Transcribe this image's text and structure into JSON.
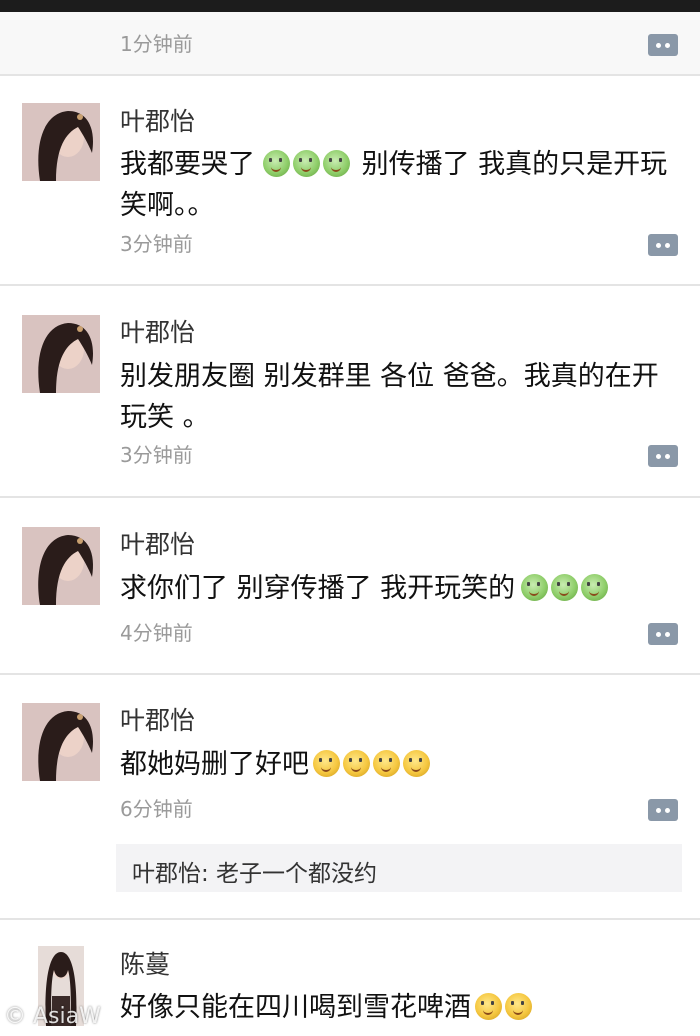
{
  "first_time": "1分钟前",
  "comments": [
    {
      "name": "叶郡怡",
      "text_a": "我都要哭了",
      "text_b": " 别传播了 我真的只是开玩笑啊。。",
      "emojis_a": [
        "green-face",
        "green-face",
        "green-face"
      ],
      "time": "3分钟前"
    },
    {
      "name": "叶郡怡",
      "text": "别发朋友圈 别发群里 各位 爸爸。我真的在开玩笑 。",
      "time": "3分钟前"
    },
    {
      "name": "叶郡怡",
      "text": "求你们了 别穿传播了 我开玩笑的",
      "emojis": [
        "green-face",
        "green-face",
        "green-face"
      ],
      "time": "4分钟前"
    },
    {
      "name": "叶郡怡",
      "text": "都她妈删了好吧",
      "emojis": [
        "yellow-face",
        "yellow-face",
        "yellow-face",
        "yellow-face"
      ],
      "time": "6分钟前",
      "reply": "叶郡怡: 老子一个都没约"
    },
    {
      "name": "陈蔓",
      "text": "好像只能在四川喝到雪花啤酒",
      "emojis": [
        "yellow-face",
        "yellow-face"
      ]
    }
  ],
  "watermark": "© AsiaW",
  "colors": {
    "emoji_green": "#8fce6a",
    "emoji_yellow": "#f5c740",
    "comment_button": "#8a98a8"
  }
}
